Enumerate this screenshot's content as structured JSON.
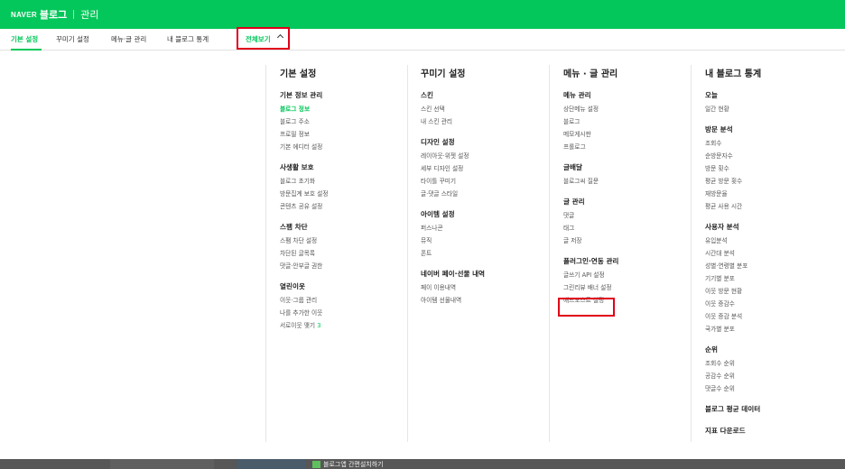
{
  "header": {
    "naver": "NAVER",
    "blog": "블로그",
    "admin": "관리"
  },
  "tabs": [
    "기본 설정",
    "꾸미기 설정",
    "메뉴·글 관리",
    "내 블로그 통계"
  ],
  "viewall": "전체보기",
  "columns": [
    {
      "title": "기본 설정",
      "groups": [
        {
          "title": "기본 정보 관리",
          "items": [
            "블로그 정보",
            "블로그 주소",
            "프로필 정보",
            "기본 에디터 설정"
          ]
        },
        {
          "title": "사생활 보호",
          "items": [
            "블로그 초기화",
            "방문집계 보호 설정",
            "콘텐츠 공유 설정"
          ]
        },
        {
          "title": "스팸 차단",
          "items": [
            "스팸 차단 설정",
            "차단된 글목록",
            "댓글·안부글 권한"
          ]
        },
        {
          "title": "열린이웃",
          "items": [
            "이웃·그룹 관리",
            "나를 추가한 이웃",
            "서로이웃 맺기"
          ]
        }
      ]
    },
    {
      "title": "꾸미기 설정",
      "groups": [
        {
          "title": "스킨",
          "items": [
            "스킨 선택",
            "내 스킨 관리"
          ]
        },
        {
          "title": "디자인 설정",
          "items": [
            "레이아웃·위젯 설정",
            "세부 디자인 설정",
            "타이틀 꾸미기",
            "글·댓글 스타일"
          ]
        },
        {
          "title": "아이템 설정",
          "items": [
            "퍼스나콘",
            "뮤직",
            "폰트"
          ]
        },
        {
          "title": "네이버 페이·선물 내역",
          "items": [
            "페이 이용내역",
            "아이템 선물내역"
          ]
        }
      ]
    },
    {
      "title": "메뉴 · 글 관리",
      "groups": [
        {
          "title": "메뉴 관리",
          "items": [
            "상단메뉴 설정",
            "블로그",
            "메모게시판",
            "프롤로그"
          ]
        },
        {
          "title": "글배달",
          "items": [
            "블로그씨 질문"
          ]
        },
        {
          "title": "글 관리",
          "items": [
            "댓글",
            "태그",
            "글 저장"
          ]
        },
        {
          "title": "플러그인·연동 관리",
          "items": [
            "글쓰기 API 설정",
            "그린리뷰 배너 설정",
            "애드포스트 설정"
          ]
        }
      ]
    },
    {
      "title": "내 블로그 통계",
      "groups": [
        {
          "title": "오늘",
          "items": [
            "일간 현황"
          ]
        },
        {
          "title": "방문 분석",
          "items": [
            "조회수",
            "순방문자수",
            "방문 횟수",
            "평균 방문 횟수",
            "재방문율",
            "평균 사용 시간"
          ]
        },
        {
          "title": "사용자 분석",
          "items": [
            "유입분석",
            "시간대 분석",
            "성별·연령별 분포",
            "기기별 분포",
            "이웃 방문 현황",
            "이웃 증감수",
            "이웃 증감 분석",
            "국가별 분포"
          ]
        },
        {
          "title": "순위",
          "items": [
            "조회수 순위",
            "공감수 순위",
            "댓글수 순위"
          ]
        },
        {
          "title": "블로그 평균 데이터",
          "items": []
        },
        {
          "title": "지표 다운로드",
          "items": []
        }
      ]
    }
  ],
  "badge": "3",
  "footer_text": "블로그앱 간편설치하기"
}
